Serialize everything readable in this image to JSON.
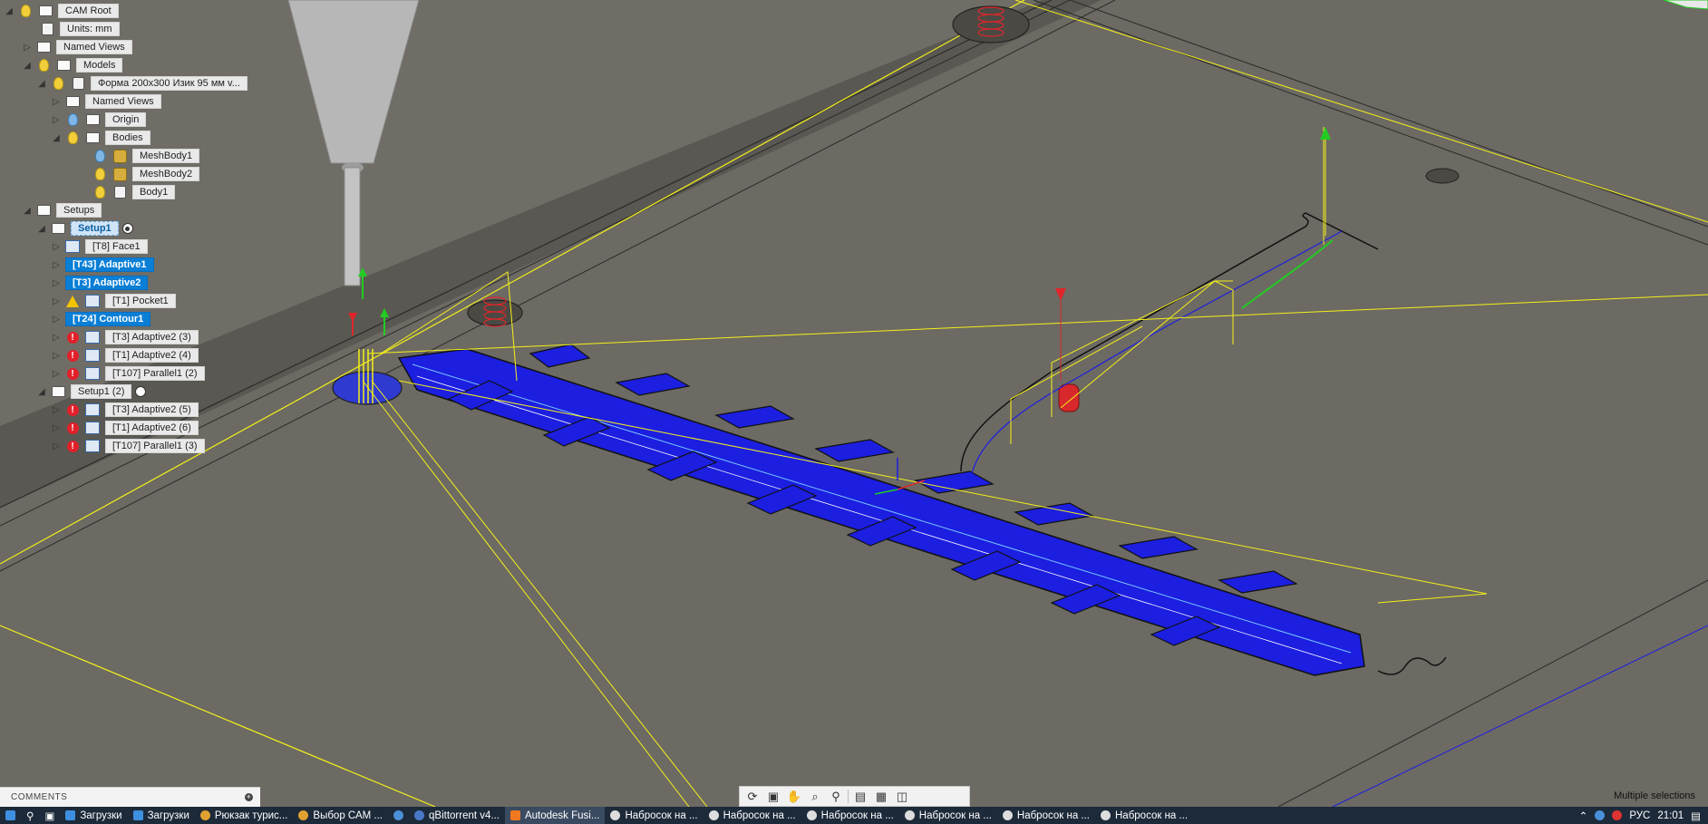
{
  "browser": {
    "items": [
      {
        "label": "CAM Root"
      },
      {
        "label": "Units: mm"
      },
      {
        "label": "Named Views"
      },
      {
        "label": "Models"
      },
      {
        "label": "Форма 200x300 Изик 95 мм v..."
      },
      {
        "label": "Named Views"
      },
      {
        "label": "Origin"
      },
      {
        "label": "Bodies"
      },
      {
        "label": "MeshBody1"
      },
      {
        "label": "MeshBody2"
      },
      {
        "label": "Body1"
      },
      {
        "label": "Setups"
      },
      {
        "label": "Setup1"
      },
      {
        "label": "[T8] Face1"
      },
      {
        "label": "[T43] Adaptive1"
      },
      {
        "label": "[T3] Adaptive2"
      },
      {
        "label": "[T1] Pocket1"
      },
      {
        "label": "[T24] Contour1"
      },
      {
        "label": "[T3] Adaptive2 (3)"
      },
      {
        "label": "[T1] Adaptive2 (4)"
      },
      {
        "label": "[T107] Parallel1 (2)"
      },
      {
        "label": "Setup1 (2)"
      },
      {
        "label": "[T3] Adaptive2 (5)"
      },
      {
        "label": "[T1] Adaptive2 (6)"
      },
      {
        "label": "[T107] Parallel1 (3)"
      }
    ]
  },
  "comments": {
    "label": "COMMENTS"
  },
  "status": {
    "text": "Multiple selections"
  },
  "taskbar": {
    "items": [
      {
        "label": "Загрузки"
      },
      {
        "label": "Загрузки"
      },
      {
        "label": "Рюкзак турис..."
      },
      {
        "label": "Выбор САМ ..."
      },
      {
        "label": "qBittorrent v4..."
      },
      {
        "label": "Autodesk Fusi..."
      },
      {
        "label": "Набросок на ..."
      },
      {
        "label": "Набросок на ..."
      },
      {
        "label": "Набросок на ..."
      },
      {
        "label": "Набросок на ..."
      },
      {
        "label": "Набросок на ..."
      },
      {
        "label": "Набросок на ..."
      }
    ],
    "language": "РУС",
    "time": "21:01"
  },
  "colors": {
    "toolpath": "#1c1ee0",
    "rapid": "#f4f019",
    "stock": "#6f6d66",
    "selected": "#0a7fd6",
    "error": "#e2202a",
    "taskbar": "#1d2a3a"
  }
}
